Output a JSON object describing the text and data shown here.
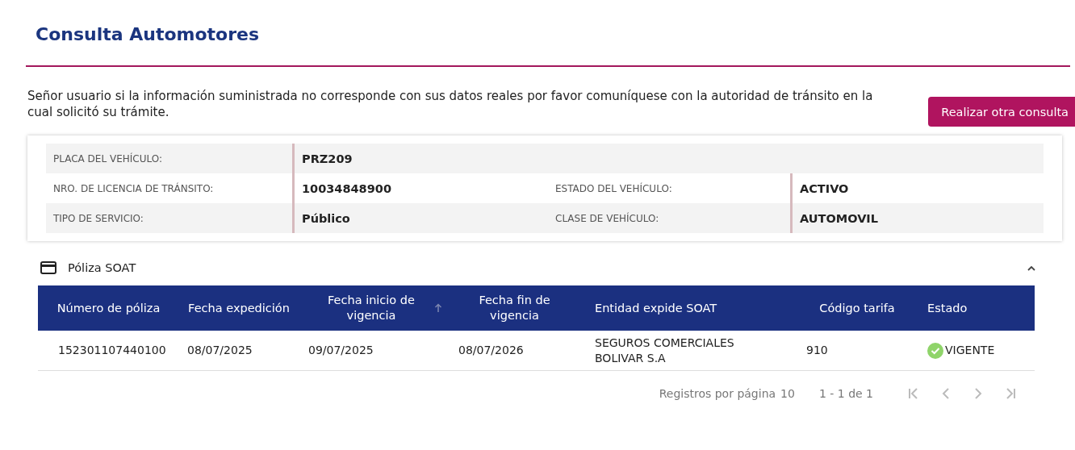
{
  "title": "Consulta Automotores",
  "notice": "Señor usuario si la información suministrada no corresponde con sus datos reales por favor comuníquese con la autoridad de tránsito en la cual solicitó su trámite.",
  "action_button": "Realizar otra consulta",
  "vehicle": [
    {
      "fields": [
        {
          "label": "PLACA DEL VEHÍCULO:",
          "value": "PRZ209"
        }
      ]
    },
    {
      "fields": [
        {
          "label": "NRO. DE LICENCIA DE TRÁNSITO:",
          "value": "10034848900"
        },
        {
          "label": "ESTADO DEL VEHÍCULO:",
          "value": "ACTIVO"
        }
      ]
    },
    {
      "fields": [
        {
          "label": "TIPO DE SERVICIO:",
          "value": "Público"
        },
        {
          "label": "CLASE DE VEHÍCULO:",
          "value": "AUTOMOVIL"
        }
      ]
    }
  ],
  "section": {
    "title": "Póliza SOAT",
    "expanded": true
  },
  "table": {
    "columns": [
      {
        "label": "Número de póliza",
        "sorted": false
      },
      {
        "label": "Fecha expedición",
        "sorted": false
      },
      {
        "label": "Fecha inicio de vigencia",
        "sorted": true
      },
      {
        "label": "Fecha fin de vigencia",
        "sorted": false
      },
      {
        "label": "Entidad expide SOAT",
        "sorted": false
      },
      {
        "label": "Código tarifa",
        "sorted": false
      },
      {
        "label": "Estado",
        "sorted": false
      }
    ],
    "rows": [
      {
        "cells": [
          "152301107440100",
          "08/07/2025",
          "09/07/2025",
          "08/07/2026",
          "SEGUROS COMERCIALES BOLIVAR S.A",
          "910",
          "VIGENTE"
        ],
        "valid": true
      }
    ]
  },
  "paginator": {
    "page_size_label": "Registros por página",
    "page_size": "10",
    "range": "1 - 1 de 1",
    "buttons": [
      {
        "kind": "first",
        "disabled": true
      },
      {
        "kind": "prev",
        "disabled": true
      },
      {
        "kind": "next",
        "disabled": true
      },
      {
        "kind": "last",
        "disabled": true
      }
    ]
  }
}
